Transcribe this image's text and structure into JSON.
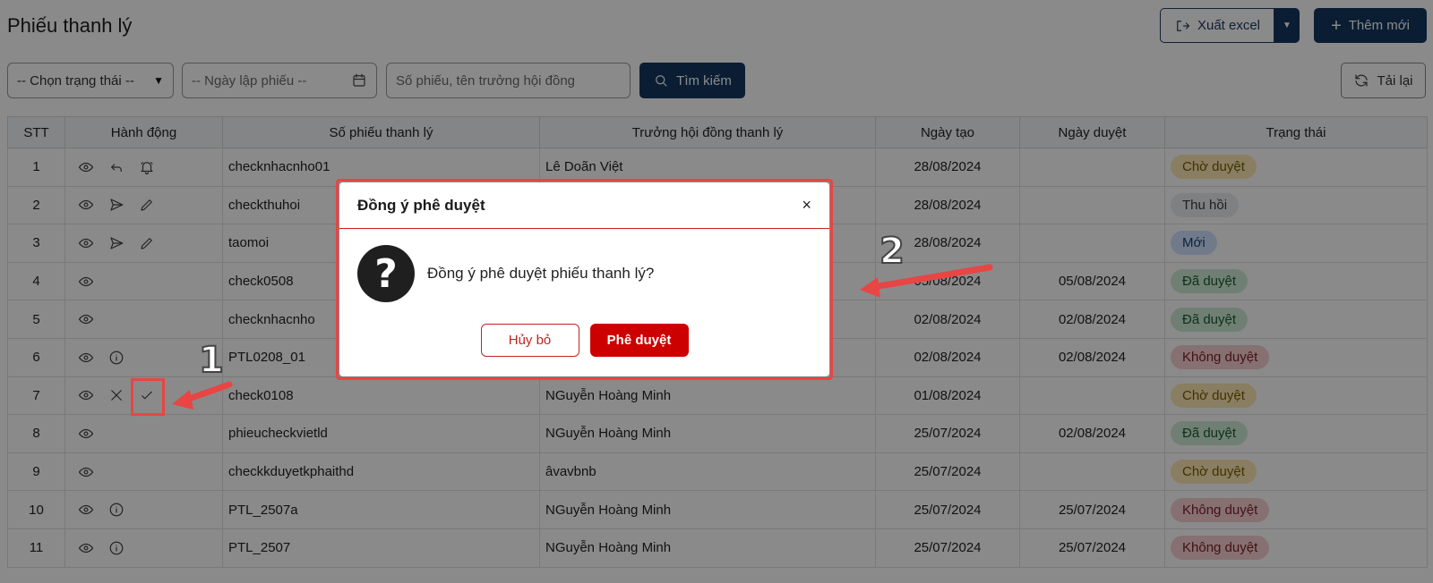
{
  "page": {
    "title": "Phiếu thanh lý"
  },
  "toolbar": {
    "export_label": "Xuất excel",
    "add_label": "Thêm mới",
    "reload_label": "Tải lại"
  },
  "filters": {
    "status_value": "-- Chọn trạng thái --",
    "date_placeholder": "-- Ngày lập phiếu --",
    "search_placeholder": "Số phiếu, tên trưởng hội đồng",
    "search_button": "Tìm kiếm"
  },
  "table": {
    "headers": {
      "stt": "STT",
      "actions": "Hành động",
      "code": "Số phiếu thanh lý",
      "chair": "Trưởng hội đồng thanh lý",
      "created": "Ngày tạo",
      "approved": "Ngày duyệt",
      "status": "Trạng thái"
    },
    "rows": [
      {
        "stt": "1",
        "code": "checknhacnho01",
        "chair": "Lê Doãn Việt",
        "created": "28/08/2024",
        "approved": "",
        "status": "Chờ duyệt",
        "status_kind": "wait",
        "actions": [
          "eye-icon",
          "undo-icon",
          "bell-icon"
        ]
      },
      {
        "stt": "2",
        "code": "checkthuhoi",
        "chair": "",
        "created": "28/08/2024",
        "approved": "",
        "status": "Thu hồi",
        "status_kind": "revoke",
        "actions": [
          "eye-icon",
          "send-icon",
          "pencil-icon"
        ]
      },
      {
        "stt": "3",
        "code": "taomoi",
        "chair": "",
        "created": "28/08/2024",
        "approved": "",
        "status": "Mới",
        "status_kind": "new",
        "actions": [
          "eye-icon",
          "send-icon",
          "pencil-icon"
        ]
      },
      {
        "stt": "4",
        "code": "check0508",
        "chair": "",
        "created": "05/08/2024",
        "approved": "05/08/2024",
        "status": "Đã duyệt",
        "status_kind": "approved",
        "actions": [
          "eye-icon"
        ]
      },
      {
        "stt": "5",
        "code": "checknhacnho",
        "chair": "",
        "created": "02/08/2024",
        "approved": "02/08/2024",
        "status": "Đã duyệt",
        "status_kind": "approved",
        "actions": [
          "eye-icon"
        ]
      },
      {
        "stt": "6",
        "code": "PTL0208_01",
        "chair": "",
        "created": "02/08/2024",
        "approved": "02/08/2024",
        "status": "Không duyệt",
        "status_kind": "rejected",
        "actions": [
          "eye-icon",
          "info-icon"
        ]
      },
      {
        "stt": "7",
        "code": "check0108",
        "chair": "NGuyễn Hoàng Minh",
        "created": "01/08/2024",
        "approved": "",
        "status": "Chờ duyệt",
        "status_kind": "wait",
        "actions": [
          "eye-icon",
          "x-icon",
          "check-icon"
        ]
      },
      {
        "stt": "8",
        "code": "phieucheckvietld",
        "chair": "NGuyễn Hoàng Minh",
        "created": "25/07/2024",
        "approved": "02/08/2024",
        "status": "Đã duyệt",
        "status_kind": "approved",
        "actions": [
          "eye-icon"
        ]
      },
      {
        "stt": "9",
        "code": "checkkduyetkphaithd",
        "chair": "âvavbnb",
        "created": "25/07/2024",
        "approved": "",
        "status": "Chờ duyệt",
        "status_kind": "wait",
        "actions": [
          "eye-icon"
        ]
      },
      {
        "stt": "10",
        "code": "PTL_2507a",
        "chair": "NGuyễn Hoàng Minh",
        "created": "25/07/2024",
        "approved": "25/07/2024",
        "status": "Không duyệt",
        "status_kind": "rejected",
        "actions": [
          "eye-icon",
          "info-icon"
        ]
      },
      {
        "stt": "11",
        "code": "PTL_2507",
        "chair": "NGuyễn Hoàng Minh",
        "created": "25/07/2024",
        "approved": "25/07/2024",
        "status": "Không duyệt",
        "status_kind": "rejected",
        "actions": [
          "eye-icon",
          "info-icon"
        ]
      }
    ]
  },
  "modal": {
    "title": "Đồng ý phê duyệt",
    "close": "×",
    "message": "Đồng ý phê duyệt phiếu thanh lý?",
    "cancel_label": "Hủy bỏ",
    "approve_label": "Phê duyệt",
    "icon": "question-icon"
  },
  "annotations": {
    "step1": "1",
    "step2": "2"
  },
  "colors": {
    "primary": "#14365f",
    "danger": "#cc0000",
    "annotation": "#e84545"
  }
}
